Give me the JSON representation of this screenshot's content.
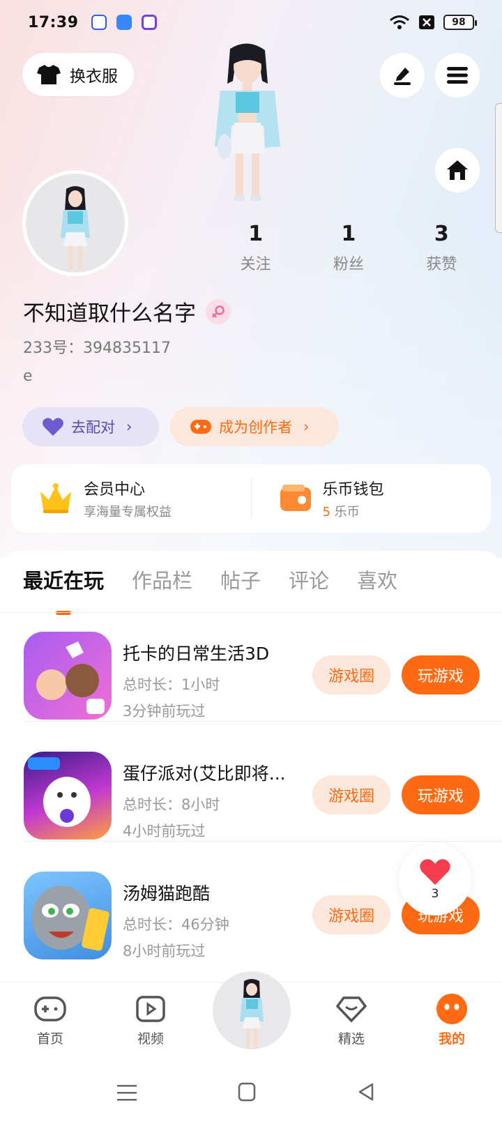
{
  "status_bar": {
    "time": "17:39",
    "battery": "98"
  },
  "header": {
    "outfit_label": "换衣服"
  },
  "stats": [
    {
      "value": "1",
      "label": "关注"
    },
    {
      "value": "1",
      "label": "粉丝"
    },
    {
      "value": "3",
      "label": "获赞"
    }
  ],
  "profile": {
    "name": "不知道取什么名字",
    "uid": "233号：394835117",
    "bio": "e"
  },
  "tags": {
    "match_label": "去配对",
    "creator_label": "成为创作者"
  },
  "cards": {
    "vip_title": "会员中心",
    "vip_sub": "享海量专属权益",
    "wallet_title": "乐币钱包",
    "wallet_amount": "5",
    "wallet_unit": " 乐币"
  },
  "tabs": [
    "最近在玩",
    "作品栏",
    "帖子",
    "评论",
    "喜欢"
  ],
  "games": [
    {
      "name": "托卡的日常生活3D",
      "duration": "总时长：1小时",
      "last_played": "3分钟前玩过",
      "circle_label": "游戏圈",
      "play_label": "玩游戏"
    },
    {
      "name": "蛋仔派对(艾比即将...",
      "duration": "总时长：8小时",
      "last_played": "4小时前玩过",
      "circle_label": "游戏圈",
      "play_label": "玩游戏"
    },
    {
      "name": "汤姆猫跑酷",
      "duration": "总时长：46分钟",
      "last_played": "8小时前玩过",
      "circle_label": "游戏圈",
      "play_label": "玩游戏"
    }
  ],
  "like_float": {
    "count": "3"
  },
  "bottom_nav": [
    {
      "label": "首页"
    },
    {
      "label": "视频"
    },
    {
      "label": "精选"
    },
    {
      "label": "我的"
    }
  ],
  "colors": {
    "accent": "#ff6a13",
    "match_bg": "#e6e2f7",
    "match_fg": "#5b4bb0",
    "creator_bg": "#fde6da"
  }
}
